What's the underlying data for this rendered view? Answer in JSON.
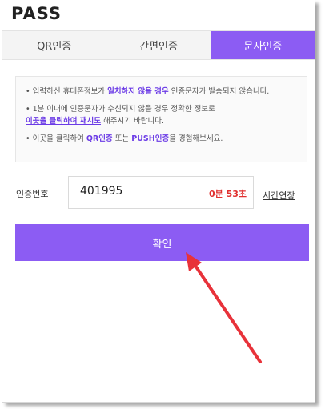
{
  "app": {
    "logo": "PASS"
  },
  "tabs": [
    {
      "label": "QR인증",
      "active": false
    },
    {
      "label": "간편인증",
      "active": false
    },
    {
      "label": "문자인증",
      "active": true
    }
  ],
  "notice": {
    "line1": {
      "pre": "• 입력하신 휴대폰정보가 ",
      "highlight": "일치하지 않을 경우",
      "post": " 인증문자가 발송되지 않습니다."
    },
    "line2": {
      "pre": "• 1분 이내에 인증문자가 수신되지 않을 경우 정확한 정보로",
      "link": "이곳을 클릭하여 재시도",
      "post": " 해주시기 바랍니다."
    },
    "line3": {
      "pre": "• 이곳을 클릭하여 ",
      "link1": "QR인증",
      "mid": " 또는 ",
      "link2": "PUSH인증",
      "post": "을 경험해보세요."
    }
  },
  "verification": {
    "label": "인증번호",
    "code": "401995",
    "timer": "0분 53초",
    "extend_label": "시간연장"
  },
  "confirm_label": "확인",
  "colors": {
    "accent": "#8c5cf3",
    "timer": "#e0302f",
    "annotation_arrow": "#e8323a"
  }
}
